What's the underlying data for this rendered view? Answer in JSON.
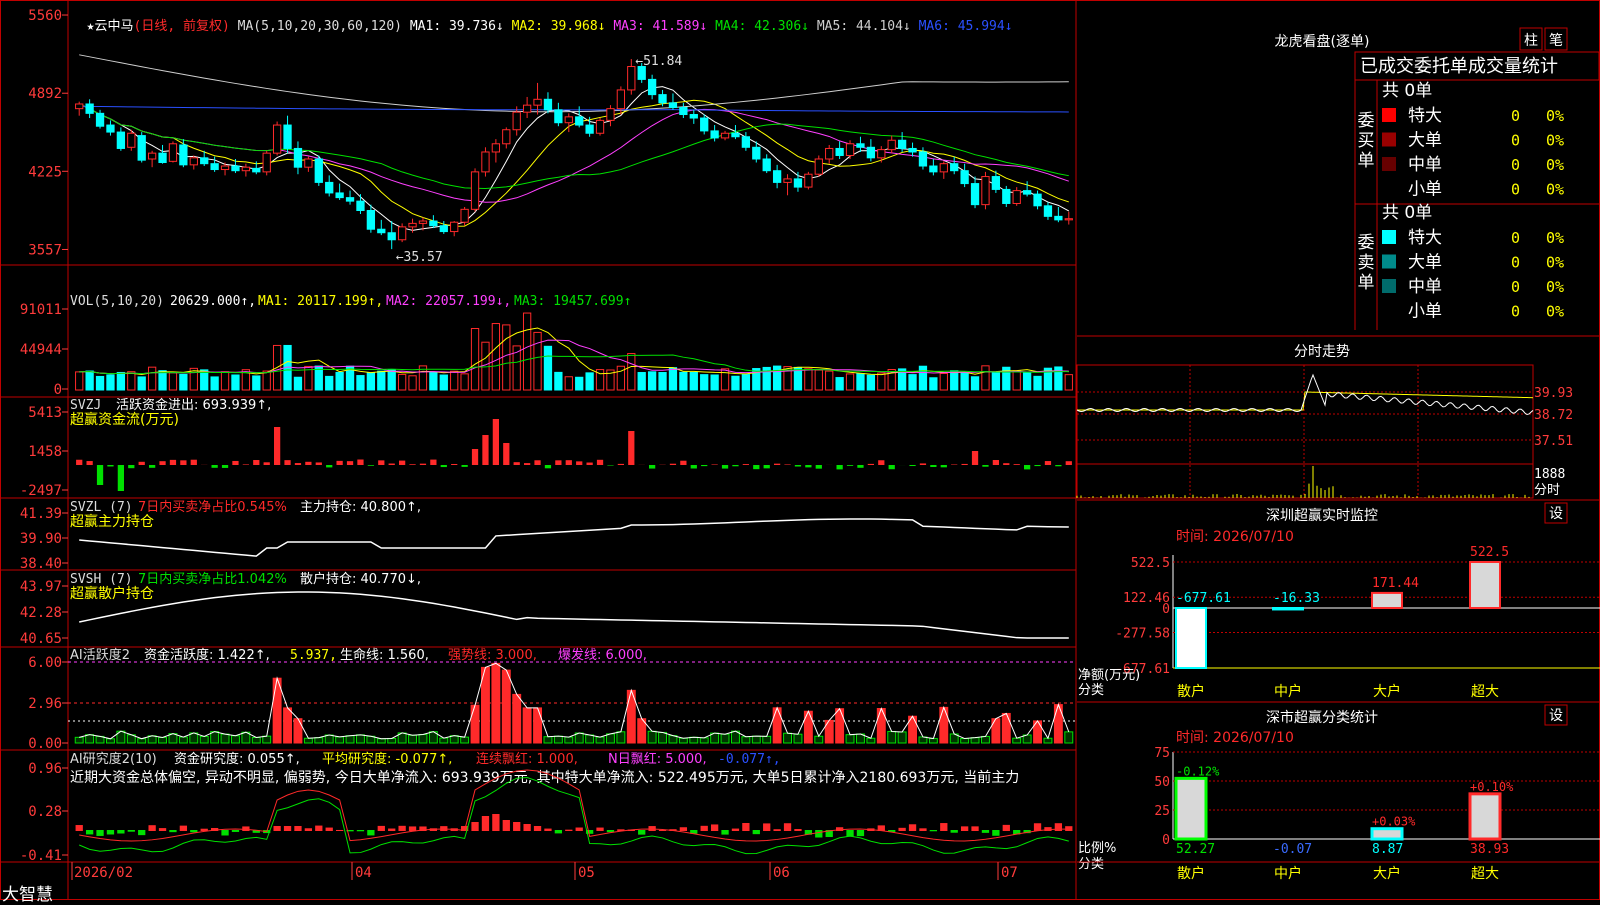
{
  "colors": {
    "up": "#ff2a2a",
    "down": "#00ffff",
    "grid": "#c00000",
    "axis": "#ff3b3b",
    "white": "#ffffff",
    "yellow": "#ffff00",
    "magenta": "#ff40ff",
    "green": "#00e000",
    "gray": "#cfcfcf",
    "blue": "#2a50ff",
    "cyan": "#00ffff"
  },
  "header": {
    "star": "★",
    "name": "云中马",
    "period": "(日线, 前复权)",
    "ma_params": "MA(5,10,20,30,60,120)",
    "ma": [
      {
        "label": "MA1:",
        "value": "39.736",
        "arrow": "↓",
        "color": "#ffffff"
      },
      {
        "label": "MA2:",
        "value": "39.968",
        "arrow": "↓",
        "color": "#ffff00"
      },
      {
        "label": "MA3:",
        "value": "41.589",
        "arrow": "↓",
        "color": "#ff40ff"
      },
      {
        "label": "MA4:",
        "value": "42.306",
        "arrow": "↓",
        "color": "#00e000"
      },
      {
        "label": "MA5:",
        "value": "44.104",
        "arrow": "↓",
        "color": "#cfcfcf"
      },
      {
        "label": "MA6:",
        "value": "45.994",
        "arrow": "↓",
        "color": "#2a50ff"
      }
    ]
  },
  "price_axis": [
    "5560",
    "4892",
    "4225",
    "3557"
  ],
  "price_annotations": {
    "high": "51.84",
    "low": "35.57"
  },
  "vol": {
    "title": "VOL(5,10,20)",
    "value": "20629.000",
    "ma1": "MA1: 20117.199",
    "ma2": "MA2: 22057.199",
    "ma3": "MA3: 19457.699",
    "axis": [
      "91011",
      "44944",
      "0"
    ]
  },
  "svzj": {
    "title": "SVZJ",
    "label": "活跃资金进出: 693.939",
    "sub": "超赢资金流(万元)",
    "axis": [
      "5413",
      "1458",
      "-2497"
    ]
  },
  "svzl": {
    "title": "SVZL (7)",
    "label1": "7日内买卖净占比0.545%",
    "label2": "主力持仓: 40.800",
    "sub": "超赢主力持仓",
    "axis": [
      "41.39",
      "39.90",
      "38.40"
    ]
  },
  "svsh": {
    "title": "SVSH (7)",
    "label1": "7日内买卖净占比1.042%",
    "label2": "散户持仓: 40.770",
    "sub": "超赢散户持仓",
    "axis": [
      "43.97",
      "42.28",
      "40.65"
    ]
  },
  "ai_active": {
    "title": "AI活跃度2",
    "label": "资金活跃度: 1.422",
    "v2": "5.937",
    "life": "生命线: 1.560",
    "strong": "强势线: 3.000",
    "burst": "爆发线: 6.000",
    "axis": [
      "6.00",
      "2.96",
      "0.00"
    ]
  },
  "ai_research": {
    "title": "AI研究度2(10)",
    "label": "资金研究度: 0.055",
    "avg": "平均研究度: -0.077",
    "lx": "连续飘红: 1.000",
    "nd": "N日飘红: 5.000",
    "v": "-0.077",
    "axis": [
      "0.96",
      "0.28",
      "-0.41"
    ],
    "note": "近期大资金总体偏空, 异动不明显, 偏弱势, 今日大单净流入: 693.939万元, 其中特大单净流入: 522.495万元, 大单5日累计净入2180.693万元, 当前主力"
  },
  "x_axis": {
    "start": "2026/02",
    "months": [
      "04",
      "05",
      "06",
      "07"
    ]
  },
  "brand": "大智慧",
  "right": {
    "lhb_title": "龙虎看盘(逐单)",
    "btn_bar": "柱",
    "btn_pen": "笔",
    "stats_header": "已成交委托单成交量统计",
    "buy_label": "委买单",
    "sell_label": "委卖单",
    "buy_total": "共 0单",
    "sell_total": "共 0单",
    "buy_rows": [
      {
        "name": "特大",
        "val": "0",
        "pct": "0%",
        "color": "#ff0000"
      },
      {
        "name": "大单",
        "val": "0",
        "pct": "0%",
        "color": "#990000"
      },
      {
        "name": "中单",
        "val": "0",
        "pct": "0%",
        "color": "#660000"
      },
      {
        "name": "小单",
        "val": "0",
        "pct": "0%",
        "color": "#000000"
      }
    ],
    "sell_rows": [
      {
        "name": "特大",
        "val": "0",
        "pct": "0%",
        "color": "#00ffff"
      },
      {
        "name": "大单",
        "val": "0",
        "pct": "0%",
        "color": "#008b8b"
      },
      {
        "name": "中单",
        "val": "0",
        "pct": "0%",
        "color": "#006b6b"
      },
      {
        "name": "小单",
        "val": "0",
        "pct": "0%",
        "color": "#000000"
      }
    ],
    "intraday_title": "分时走势",
    "intraday_axis": [
      "39.93",
      "38.72",
      "37.51"
    ],
    "intraday_vol": [
      "1888",
      "分时"
    ],
    "sz_title": "深圳超赢实时监控",
    "sz_btn": "设",
    "sz_time": "时间: 2026/07/10",
    "sz_axis": [
      "522.5",
      "122.46",
      "0",
      "-277.58",
      "-677.61"
    ],
    "sz_ylabel": [
      "净额(万元)",
      "分类"
    ],
    "sz_bars": [
      {
        "cat": "散户",
        "value": -677.61,
        "label": "-677.61"
      },
      {
        "cat": "中户",
        "value": -16.33,
        "label": "-16.33"
      },
      {
        "cat": "大户",
        "value": 171.44,
        "label": "171.44"
      },
      {
        "cat": "超大",
        "value": 522.5,
        "label": "522.5"
      }
    ],
    "class_title": "深市超赢分类统计",
    "class_btn": "设",
    "class_time": "时间: 2026/07/10",
    "class_axis": [
      "75",
      "50",
      "25",
      "0"
    ],
    "class_ylabel": [
      "比例%",
      "分类"
    ],
    "class_bars": [
      {
        "cat": "散户",
        "value": 52.27,
        "change": "-0.12%",
        "label": "52.27"
      },
      {
        "cat": "中户",
        "value": 0.0,
        "change": "",
        "label": "-0.07"
      },
      {
        "cat": "大户",
        "value": 8.87,
        "change": "+0.03%",
        "label": "8.87"
      },
      {
        "cat": "超大",
        "value": 38.93,
        "change": "+0.10%",
        "label": "38.93"
      }
    ]
  },
  "chart_data": {
    "type": "bar",
    "title": "云中马 (日线, 前复权)",
    "candles": [
      [
        47.6,
        48.2,
        47.0,
        48.0
      ],
      [
        48.0,
        48.4,
        46.8,
        47.2
      ],
      [
        47.2,
        47.5,
        45.9,
        46.1
      ],
      [
        46.2,
        46.6,
        45.3,
        45.6
      ],
      [
        45.6,
        46.0,
        44.0,
        44.2
      ],
      [
        44.3,
        45.8,
        44.0,
        45.5
      ],
      [
        45.3,
        45.6,
        43.0,
        43.2
      ],
      [
        43.3,
        44.0,
        42.6,
        43.8
      ],
      [
        43.8,
        44.5,
        42.9,
        43.0
      ],
      [
        43.1,
        44.8,
        43.0,
        44.6
      ],
      [
        44.5,
        45.0,
        42.6,
        42.8
      ],
      [
        42.8,
        43.6,
        42.4,
        43.4
      ],
      [
        43.4,
        44.0,
        42.7,
        42.9
      ],
      [
        42.9,
        43.5,
        42.2,
        42.4
      ],
      [
        42.4,
        43.0,
        41.9,
        42.7
      ],
      [
        42.7,
        43.3,
        42.1,
        42.3
      ],
      [
        42.3,
        42.9,
        41.8,
        42.6
      ],
      [
        42.5,
        43.1,
        42.0,
        42.2
      ],
      [
        42.2,
        44.0,
        41.9,
        43.8
      ],
      [
        43.8,
        46.5,
        43.6,
        46.2
      ],
      [
        46.2,
        47.0,
        43.8,
        44.2
      ],
      [
        44.2,
        44.8,
        42.0,
        42.6
      ],
      [
        42.6,
        43.5,
        42.2,
        43.3
      ],
      [
        43.3,
        43.6,
        41.0,
        41.3
      ],
      [
        41.3,
        41.9,
        40.1,
        40.4
      ],
      [
        40.4,
        41.2,
        39.8,
        40.0
      ],
      [
        40.0,
        40.6,
        39.4,
        39.7
      ],
      [
        39.7,
        40.3,
        38.6,
        38.9
      ],
      [
        38.9,
        39.4,
        37.0,
        37.3
      ],
      [
        37.3,
        38.1,
        36.8,
        37.0
      ],
      [
        37.0,
        38.0,
        35.6,
        36.4
      ],
      [
        36.4,
        37.8,
        36.2,
        37.5
      ],
      [
        37.5,
        38.2,
        37.0,
        37.8
      ],
      [
        37.8,
        38.3,
        37.2,
        38.0
      ],
      [
        38.0,
        38.5,
        37.4,
        37.6
      ],
      [
        37.6,
        38.0,
        36.9,
        37.1
      ],
      [
        37.1,
        38.0,
        36.7,
        37.9
      ],
      [
        37.9,
        39.2,
        37.6,
        39.0
      ],
      [
        39.0,
        42.5,
        38.8,
        42.2
      ],
      [
        42.2,
        44.3,
        41.8,
        43.9
      ],
      [
        43.9,
        45.0,
        43.0,
        44.6
      ],
      [
        44.6,
        46.0,
        44.2,
        45.8
      ],
      [
        45.8,
        47.8,
        45.3,
        47.3
      ],
      [
        47.3,
        48.6,
        46.8,
        47.9
      ],
      [
        47.9,
        49.8,
        47.1,
        48.4
      ],
      [
        48.4,
        49.0,
        47.2,
        47.5
      ],
      [
        47.5,
        48.1,
        46.1,
        46.4
      ],
      [
        46.4,
        47.2,
        45.6,
        46.9
      ],
      [
        46.9,
        47.8,
        46.0,
        46.2
      ],
      [
        46.2,
        46.9,
        45.2,
        45.5
      ],
      [
        45.5,
        46.8,
        45.3,
        46.6
      ],
      [
        46.6,
        47.9,
        46.1,
        47.6
      ],
      [
        47.6,
        49.5,
        47.1,
        49.2
      ],
      [
        49.2,
        51.84,
        48.8,
        51.2
      ],
      [
        51.2,
        51.5,
        49.8,
        50.1
      ],
      [
        50.1,
        50.5,
        48.4,
        48.8
      ],
      [
        48.8,
        49.2,
        47.8,
        48.1
      ],
      [
        48.1,
        48.9,
        47.5,
        47.7
      ],
      [
        47.7,
        48.1,
        46.8,
        47.1
      ],
      [
        47.1,
        47.5,
        46.3,
        46.8
      ],
      [
        46.8,
        47.1,
        45.4,
        45.7
      ],
      [
        45.7,
        46.2,
        44.8,
        45.1
      ],
      [
        45.1,
        45.7,
        44.9,
        45.5
      ],
      [
        45.5,
        46.2,
        45.0,
        45.2
      ],
      [
        45.2,
        45.6,
        44.0,
        44.3
      ],
      [
        44.3,
        44.8,
        43.0,
        43.3
      ],
      [
        43.3,
        43.7,
        42.1,
        42.3
      ],
      [
        42.3,
        42.8,
        40.8,
        41.3
      ],
      [
        41.3,
        42.0,
        40.2,
        41.6
      ],
      [
        41.6,
        42.2,
        40.5,
        40.9
      ],
      [
        40.9,
        42.2,
        40.7,
        42.0
      ],
      [
        42.0,
        43.6,
        41.8,
        43.3
      ],
      [
        43.3,
        44.5,
        42.9,
        44.2
      ],
      [
        44.2,
        44.8,
        43.3,
        43.6
      ],
      [
        43.6,
        44.9,
        43.3,
        44.6
      ],
      [
        44.6,
        45.2,
        43.9,
        44.3
      ],
      [
        44.3,
        45.0,
        43.1,
        43.4
      ],
      [
        43.4,
        44.4,
        43.0,
        44.1
      ],
      [
        44.1,
        45.3,
        43.8,
        44.9
      ],
      [
        44.9,
        45.6,
        43.9,
        44.2
      ],
      [
        44.2,
        44.7,
        43.5,
        43.9
      ],
      [
        43.9,
        44.3,
        42.4,
        42.7
      ],
      [
        42.7,
        43.3,
        41.9,
        42.2
      ],
      [
        42.2,
        43.1,
        41.6,
        42.9
      ],
      [
        42.9,
        43.5,
        42.0,
        42.3
      ],
      [
        42.3,
        42.9,
        40.9,
        41.2
      ],
      [
        41.2,
        41.8,
        39.1,
        39.4
      ],
      [
        39.4,
        42.2,
        39.0,
        41.8
      ],
      [
        41.8,
        42.3,
        40.4,
        40.7
      ],
      [
        40.7,
        41.0,
        39.2,
        39.5
      ],
      [
        39.5,
        40.9,
        39.3,
        40.6
      ],
      [
        40.6,
        41.4,
        40.1,
        40.3
      ],
      [
        40.3,
        40.6,
        39.0,
        39.3
      ],
      [
        39.3,
        39.6,
        38.1,
        38.4
      ],
      [
        38.4,
        39.2,
        37.9,
        38.1
      ],
      [
        38.1,
        38.8,
        37.7,
        38.2
      ]
    ]
  }
}
